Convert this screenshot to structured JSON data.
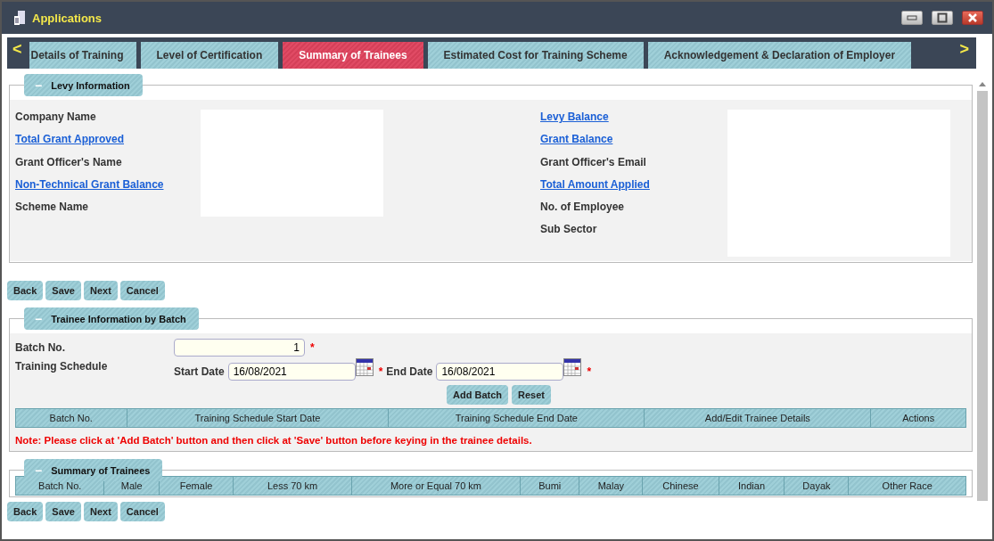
{
  "window": {
    "title": "Applications"
  },
  "tabs_nav": {
    "prev": "<",
    "next": ">"
  },
  "tabs": [
    {
      "label": "Details of Training",
      "selected": false
    },
    {
      "label": "Level of Certification",
      "selected": false
    },
    {
      "label": "Summary of Trainees",
      "selected": true
    },
    {
      "label": "Estimated Cost for Training Scheme",
      "selected": false
    },
    {
      "label": "Acknowledgement & Declaration of Employer",
      "selected": false
    }
  ],
  "levy_information": {
    "legend": "Levy Information",
    "collapse_icon": "−",
    "left_fields": [
      {
        "label": "Company Name",
        "kind": "text"
      },
      {
        "label": "Total Grant Approved",
        "kind": "link"
      },
      {
        "label": "Grant Officer's Name",
        "kind": "text"
      },
      {
        "label": "Non-Technical Grant Balance",
        "kind": "link"
      },
      {
        "label": "Scheme Name",
        "kind": "text"
      }
    ],
    "right_fields": [
      {
        "label": "Levy Balance",
        "kind": "link"
      },
      {
        "label": "Grant Balance",
        "kind": "link"
      },
      {
        "label": "Grant Officer's Email",
        "kind": "text"
      },
      {
        "label": "Total Amount Applied",
        "kind": "link"
      },
      {
        "label": "No. of Employee",
        "kind": "text"
      },
      {
        "label": "Sub Sector",
        "kind": "text"
      }
    ]
  },
  "buttons_top": [
    "Back",
    "Save",
    "Next",
    "Cancel"
  ],
  "trainee_information": {
    "legend": "Trainee Information by Batch",
    "collapse_icon": "−",
    "batch_no": {
      "label": "Batch No.",
      "value": "1",
      "required": "*"
    },
    "training_schedule": {
      "label": "Training Schedule",
      "start_label": "Start Date",
      "start_value": "16/08/2021",
      "start_required": "*",
      "end_label": "End Date",
      "end_value": "16/08/2021",
      "end_required": "*"
    },
    "actions": [
      "Add Batch",
      "Reset"
    ],
    "table": {
      "columns": [
        "Batch No.",
        "Training Schedule Start Date",
        "Training Schedule End Date",
        "Add/Edit Trainee Details",
        "Actions"
      ]
    },
    "note": "Note: Please click at 'Add Batch' button and then click at 'Save' button before keying in the trainee details."
  },
  "summary_of_trainees": {
    "legend": "Summary of Trainees",
    "collapse_icon": "−",
    "table": {
      "columns": [
        "Batch No.",
        "Male",
        "Female",
        "Less 70 km",
        "More or Equal 70 km",
        "Bumi",
        "Malay",
        "Chinese",
        "Indian",
        "Dayak",
        "Other Race"
      ]
    }
  },
  "buttons_bottom": [
    "Back",
    "Save",
    "Next",
    "Cancel"
  ]
}
